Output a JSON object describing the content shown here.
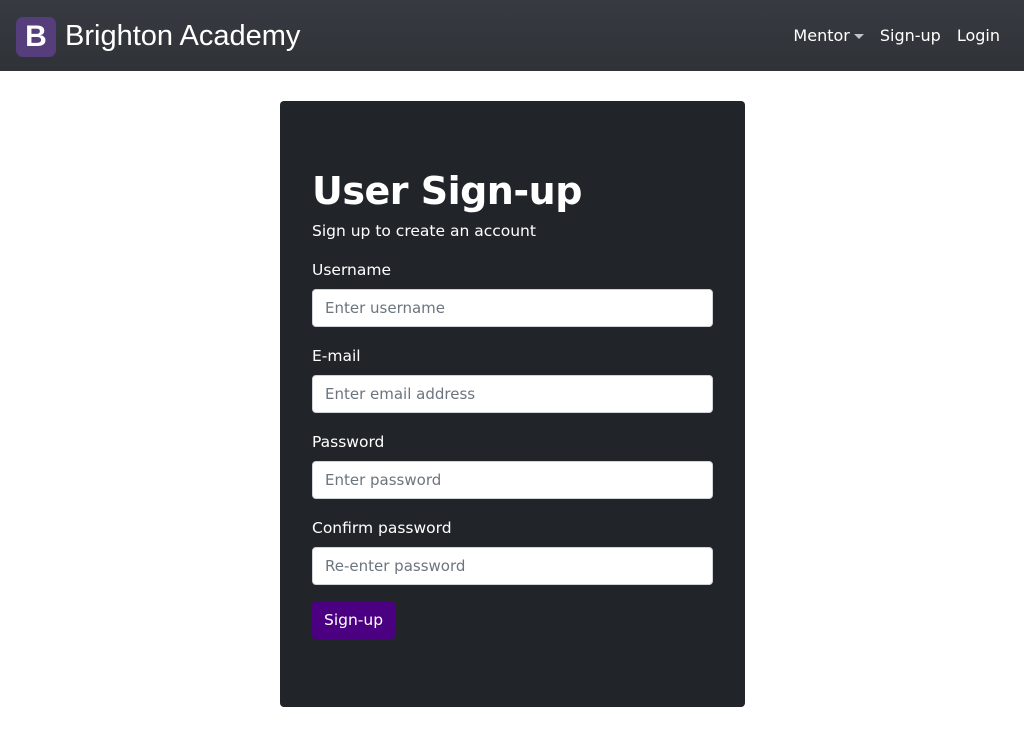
{
  "navbar": {
    "logo_letter": "B",
    "brand_name": "Brighton Academy",
    "items": [
      {
        "label": "Mentor",
        "dropdown": true
      },
      {
        "label": "Sign-up"
      },
      {
        "label": "Login"
      }
    ]
  },
  "form": {
    "title": "User Sign-up",
    "subtitle": "Sign up to create an account",
    "fields": [
      {
        "label": "Username",
        "placeholder": "Enter username",
        "value": ""
      },
      {
        "label": "E-mail",
        "placeholder": "Enter email address",
        "value": ""
      },
      {
        "label": "Password",
        "placeholder": "Enter password",
        "value": ""
      },
      {
        "label": "Confirm password",
        "placeholder": "Re-enter password",
        "value": ""
      }
    ],
    "submit_label": "Sign-up"
  },
  "colors": {
    "navbar_bg": "#343a40",
    "logo_bg": "#563d7c",
    "card_bg": "#212429",
    "button_bg": "#4b0082"
  },
  "icons": {
    "mentor_dropdown": "caret-down-icon"
  }
}
